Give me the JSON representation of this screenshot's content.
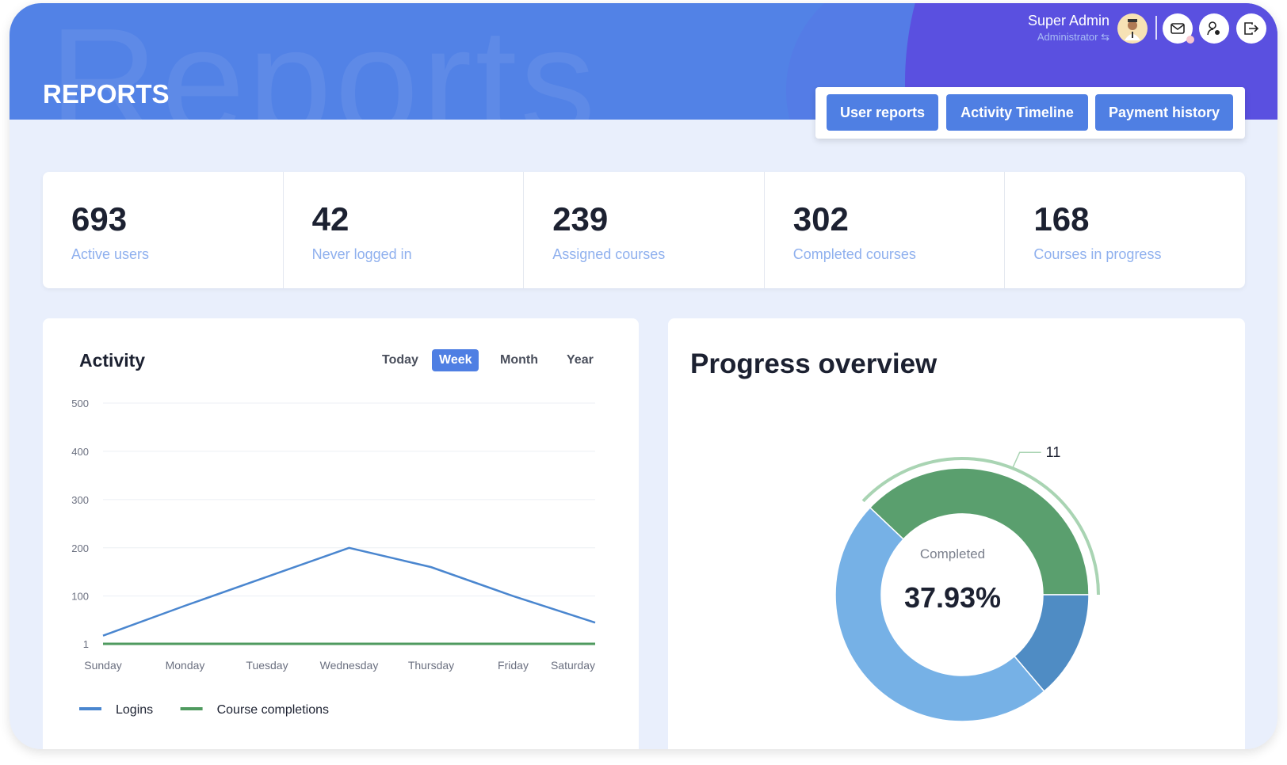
{
  "header": {
    "title": "REPORTS",
    "watermark": "Reports",
    "user_name": "Super Admin",
    "user_role": "Administrator",
    "icons": [
      "avatar",
      "mail-icon",
      "user-settings-icon",
      "logout-icon"
    ]
  },
  "tabs": [
    {
      "label": "User reports"
    },
    {
      "label": "Activity Timeline"
    },
    {
      "label": "Payment history"
    }
  ],
  "stats": [
    {
      "value": "693",
      "label": "Active users"
    },
    {
      "value": "42",
      "label": "Never logged in"
    },
    {
      "value": "239",
      "label": "Assigned courses"
    },
    {
      "value": "302",
      "label": "Completed courses"
    },
    {
      "value": "168",
      "label": "Courses in progress"
    }
  ],
  "activity": {
    "title": "Activity",
    "ranges": [
      "Today",
      "Week",
      "Month",
      "Year"
    ],
    "selected_range": "Week"
  },
  "progress": {
    "title": "Progress overview",
    "center_label": "Completed",
    "center_value": "37.93%"
  },
  "colors": {
    "accent": "#4f7fe3",
    "logins": "#4a86cf",
    "completions": "#4f9a5f",
    "green": "#5a9f6e",
    "dark_blue": "#4f8cc4",
    "light_blue": "#76b1e6"
  },
  "chart_data": [
    {
      "type": "line",
      "categories": [
        "Sunday",
        "Monday",
        "Tuesday",
        "Wednesday",
        "Thursday",
        "Friday",
        "Saturday"
      ],
      "yticks": [
        "1",
        "100",
        "200",
        "300",
        "400",
        "500"
      ],
      "ylim": [
        1,
        500
      ],
      "grid": true,
      "legend": "bottom-left",
      "series": [
        {
          "name": "Logins",
          "values": [
            18,
            80,
            140,
            200,
            160,
            100,
            45
          ]
        },
        {
          "name": "Course completions",
          "values": [
            1,
            1,
            1,
            1,
            1,
            1,
            1
          ]
        }
      ]
    },
    {
      "type": "pie",
      "values": [
        11,
        4,
        14
      ],
      "highlighted_label": "11"
    }
  ]
}
